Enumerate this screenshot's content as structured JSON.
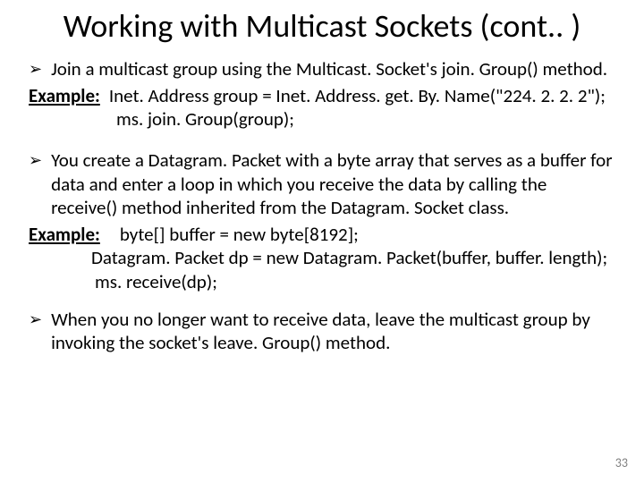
{
  "title": "Working with Multicast Sockets (cont.. )",
  "bullet1": "Join a multicast group using the Multicast. Socket's join. Group() method.",
  "example_label": "Example:",
  "code1a": "Inet. Address group = Inet. Address. get. By. Name(\"224. 2. 2. 2\");",
  "code1b": "ms. join. Group(group);",
  "bullet2": "You create a Datagram. Packet with a byte array that serves as a buffer for data and enter a loop in which you receive the data by calling the receive() method inherited from the Datagram. Socket class.",
  "code2a": "byte[] buffer = new byte[8192];",
  "code2b": "Datagram. Packet dp = new Datagram. Packet(buffer, buffer. length);",
  "code2c": "ms. receive(dp);",
  "bullet3": "When you no longer want to receive data, leave the multicast group by invoking the socket's leave. Group() method.",
  "page_number": "33"
}
